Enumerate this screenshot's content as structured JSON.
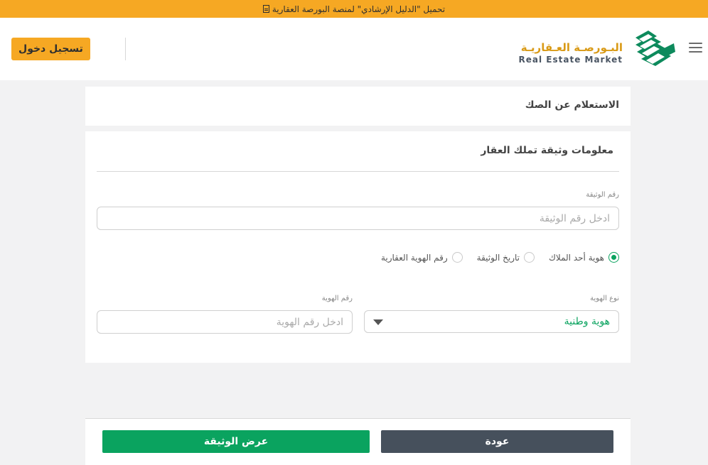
{
  "announcement": {
    "text": "تحميل \"الدليل الإرشادي\" لمنصة البورصة العقارية",
    "icon": "document-icon"
  },
  "header": {
    "logo_arabic": "البـورصـة العـقاريـة",
    "logo_english": "Real Estate Market",
    "login_label": "تسجيل دخول",
    "menu_icon": "hamburger-icon",
    "colors": {
      "accent": "#f6a823",
      "logo_green": "#0d8a5c"
    }
  },
  "page": {
    "title": "الاستعلام عن الصك"
  },
  "form": {
    "section_title": "معلومات وثيقة تملك العقار",
    "document_number_label": "رقم الوثيقة",
    "document_number_placeholder": "ادخل رقم الوثيقة",
    "radio_options": [
      {
        "label": "هوية أحد الملاك",
        "selected": true
      },
      {
        "label": "تاريخ الوثيقة",
        "selected": false
      },
      {
        "label": "رقم الهوية العقارية",
        "selected": false
      }
    ],
    "id_type_label": "نوع الهوية",
    "id_type_value": "هوية وطنية",
    "id_number_label": "رقم الهوية",
    "id_number_placeholder": "ادخل رقم الهوية"
  },
  "footer": {
    "back_label": "عودة",
    "view_label": "عرض الوثيقة",
    "colors": {
      "back": "#46505c",
      "view": "#0aa35f"
    }
  }
}
